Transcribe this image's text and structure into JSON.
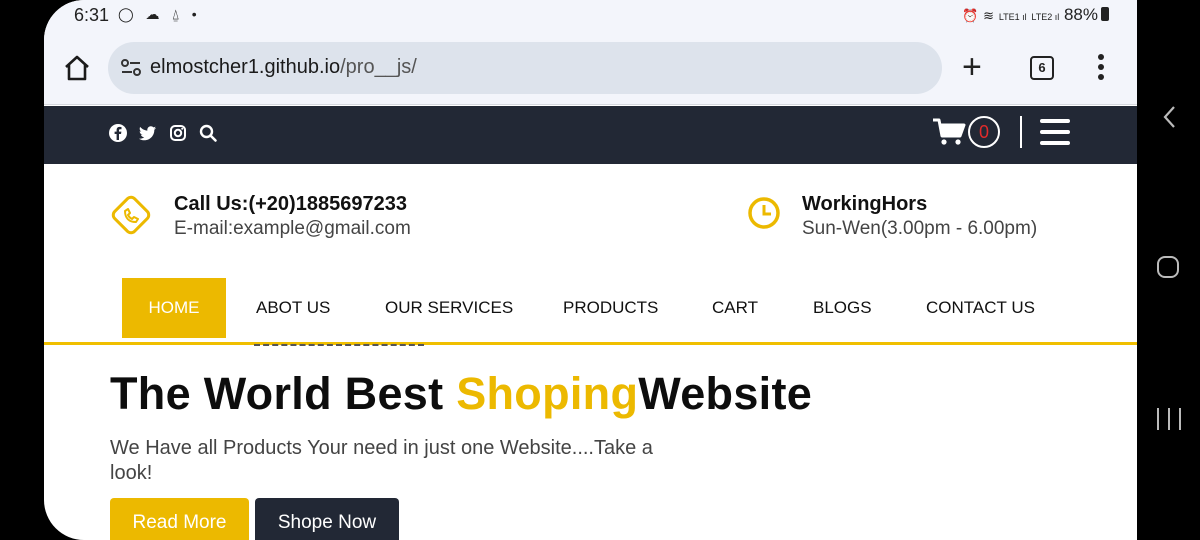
{
  "status_bar": {
    "time": "6:31",
    "battery": "88%",
    "left_icons": "whatsapp-icon cloud-icon bell-off-icon dot",
    "right_icons": "alarm-icon wifi-icon LTE1-signal LTE2-signal"
  },
  "browser": {
    "url_host": "elmostcher1.github.io",
    "url_path": "/pro__js/",
    "tab_count": "6"
  },
  "topnav": {
    "social_icons": [
      "facebook-icon",
      "twitter-icon",
      "instagram-icon",
      "search-icon"
    ],
    "cart_count": "0"
  },
  "contact": {
    "call": "Call Us:(+20)1885697233",
    "email": "E-mail:example@gmail.com"
  },
  "hours": {
    "title": "WorkingHors",
    "time": "Sun-Wen(3.00pm - 6.00pm)"
  },
  "nav": {
    "items": [
      "HOME",
      "ABOT US",
      "OUR SERVICES",
      "PRODUCTS",
      "CART",
      "BLOGS",
      "CONTACT US"
    ],
    "active": "HOME"
  },
  "hero": {
    "title_part1": "The World Best ",
    "title_accent": "Shoping",
    "title_part2": "Website",
    "subtitle": "We Have all Products Your need in just one Website....Take a look!",
    "read_more": "Read More",
    "shop_now": "Shope Now"
  },
  "colors": {
    "accent": "#ecb900",
    "dark": "#222835",
    "cart_count": "#e12b2b"
  }
}
